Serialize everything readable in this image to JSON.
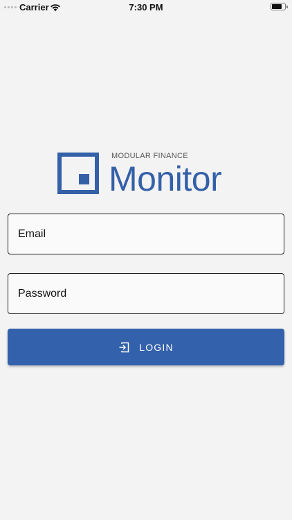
{
  "status_bar": {
    "carrier": "Carrier",
    "time": "7:30 PM",
    "battery_level": 0.8
  },
  "logo": {
    "company": "MODULAR FINANCE",
    "product": "Monitor"
  },
  "form": {
    "email_placeholder": "Email",
    "password_placeholder": "Password",
    "login_label": "LOGIN"
  },
  "colors": {
    "brand": "#3460a8",
    "background": "#f3f3f3"
  },
  "icons": {
    "login": "login-enter-icon",
    "wifi": "wifi-icon",
    "battery": "battery-icon"
  }
}
